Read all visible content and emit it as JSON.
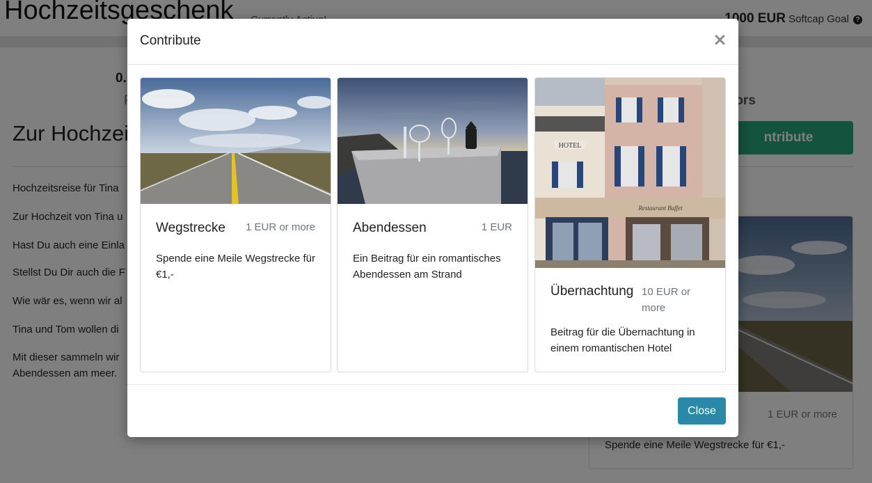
{
  "page": {
    "title": "Hochzeitsgeschenk",
    "status": "Currently Active!",
    "goal_amount": "1000 EUR",
    "goal_label": "Softcap Goal",
    "help_glyph": "?",
    "raised_amount": "0.",
    "raised_label": "R",
    "contributors_label": "tors",
    "contribute_label": "ntribute",
    "heading": "Zur Hochzeit",
    "paragraphs": [
      "Hochzeitsreise für Tina",
      "Zur Hochzeit von Tina u",
      "Hast Du auch eine Einla",
      "Stellst Du Dir auch die F",
      "Wie wär es, wenn wir al",
      "Tina und Tom wollen di",
      "Mit dieser sammeln wir",
      "Abendessen am meer."
    ],
    "side_card": {
      "price": "1 EUR or more",
      "description": "Spende eine Meile Wegstrecke für €1,-"
    }
  },
  "modal": {
    "title": "Contribute",
    "close_glyph": "×",
    "close_button": "Close",
    "rewards": [
      {
        "title": "Wegstrecke",
        "price": "1 EUR or more",
        "description": "Spende eine Meile Wegstrecke für €1,-",
        "image": "road-image"
      },
      {
        "title": "Abendessen",
        "price": "1 EUR",
        "description": "Ein Beitrag für ein romantisches Abendessen am Strand",
        "image": "beach-dinner-image"
      },
      {
        "title": "Übernachtung",
        "price": "10 EUR or more",
        "description": "Beitrag für die Übernachtung in einem romantischen Hotel",
        "image": "hotel-image"
      }
    ]
  },
  "colors": {
    "accent_green": "#28a77a",
    "close_button": "#2b89a8",
    "overlay": "rgba(0,0,0,0.5)"
  }
}
